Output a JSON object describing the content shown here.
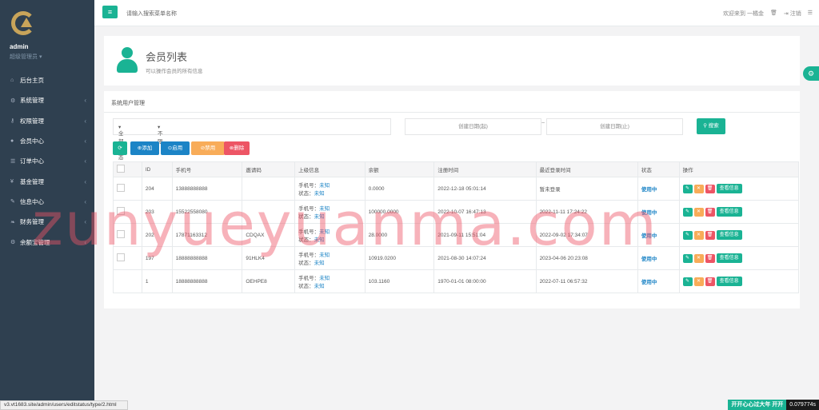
{
  "sidebar": {
    "user": "admin",
    "role": "超级管理员",
    "items": [
      {
        "icon": "home-icon",
        "glyph": "⌂",
        "label": "后台主页",
        "arrow": ""
      },
      {
        "icon": "gears-icon",
        "glyph": "⚙",
        "label": "系统管理",
        "arrow": "‹"
      },
      {
        "icon": "key-icon",
        "glyph": "⚷",
        "label": "权限管理",
        "arrow": "‹"
      },
      {
        "icon": "user-icon",
        "glyph": "●",
        "label": "会员中心",
        "arrow": "‹"
      },
      {
        "icon": "list-icon",
        "glyph": "☰",
        "label": "订单中心",
        "arrow": "‹"
      },
      {
        "icon": "yen-icon",
        "glyph": "¥",
        "label": "基金管理",
        "arrow": "‹"
      },
      {
        "icon": "wrench-icon",
        "glyph": "✎",
        "label": "信息中心",
        "arrow": "‹"
      },
      {
        "icon": "leaf-icon",
        "glyph": "❧",
        "label": "财务管理",
        "arrow": "‹"
      },
      {
        "icon": "gears-icon",
        "glyph": "⚙",
        "label": "余额宝管理",
        "arrow": "‹"
      }
    ]
  },
  "topbar": {
    "menu_glyph": "≡",
    "search_placeholder": "请输入搜索菜单名称",
    "welcome": "欢迎来到 一橘金",
    "logout": "注销"
  },
  "hero": {
    "title": "会员列表",
    "subtitle": "可以操作会员的所有信息"
  },
  "panel": {
    "title": "系统用户管理"
  },
  "filters": {
    "status": "全部状态",
    "limit": "不限",
    "date_start": "创建日期(起)",
    "tilde": "~",
    "date_end": "创建日期(止)",
    "search": "搜索"
  },
  "actions": {
    "refresh": "⟳",
    "add": "添加",
    "enable": "启用",
    "disable": "禁用",
    "delete": "删除"
  },
  "table": {
    "headers": [
      "",
      "ID",
      "手机号",
      "邀请码",
      "上级信息",
      "余额",
      "注册时间",
      "最近登录时间",
      "状态",
      "操作"
    ],
    "rows": [
      {
        "id": "204",
        "phone": "13888888888",
        "invite": "",
        "parent_phone": "未知",
        "parent_status": "未知",
        "balance": "0.0000",
        "reg": "2022-12-18 05:01:14",
        "last": "暂未登录",
        "status": "使用中",
        "checkbox": true
      },
      {
        "id": "203",
        "phone": "15522558080",
        "invite": "",
        "parent_phone": "未知",
        "parent_status": "未知",
        "balance": "100000.0000",
        "reg": "2022-10-07 16:47:13",
        "last": "2022-11-11 17:24:22",
        "status": "使用中",
        "checkbox": true
      },
      {
        "id": "202",
        "phone": "17871163312",
        "invite": "CDQAX",
        "parent_phone": "未知",
        "parent_status": "未知",
        "balance": "28.0000",
        "reg": "2021-09-11 15:51:04",
        "last": "2022-09-02 17:34:07",
        "status": "使用中",
        "checkbox": true
      },
      {
        "id": "197",
        "phone": "18888888888",
        "invite": "91HLK4",
        "parent_phone": "未知",
        "parent_status": "未知",
        "balance": "10919.0200",
        "reg": "2021-08-30 14:07:24",
        "last": "2023-04-06 20:23:08",
        "status": "使用中",
        "checkbox": true
      },
      {
        "id": "1",
        "phone": "18888888888",
        "invite": "OEHPE8",
        "parent_phone": "未知",
        "parent_status": "未知",
        "balance": "103.1160",
        "reg": "1970-01-01 08:00:00",
        "last": "2022-07-11 06:57:32",
        "status": "使用中",
        "checkbox": false
      }
    ],
    "parent_phone_label": "手机号：",
    "parent_status_label": "状态：",
    "view_label": "查看信息"
  },
  "watermark": "zunyueyuanma.com",
  "status_url": "v3.vt1683.site/admin/users/editstatus/type/2.html",
  "bottom": {
    "marquee": "开开心心过大年 开开",
    "timer": "0.079774s"
  },
  "colors": {
    "primary": "#1ab394",
    "info": "#1c84c6",
    "warning": "#f8ac59",
    "danger": "#ed5565",
    "sidebar": "#2f4050"
  }
}
